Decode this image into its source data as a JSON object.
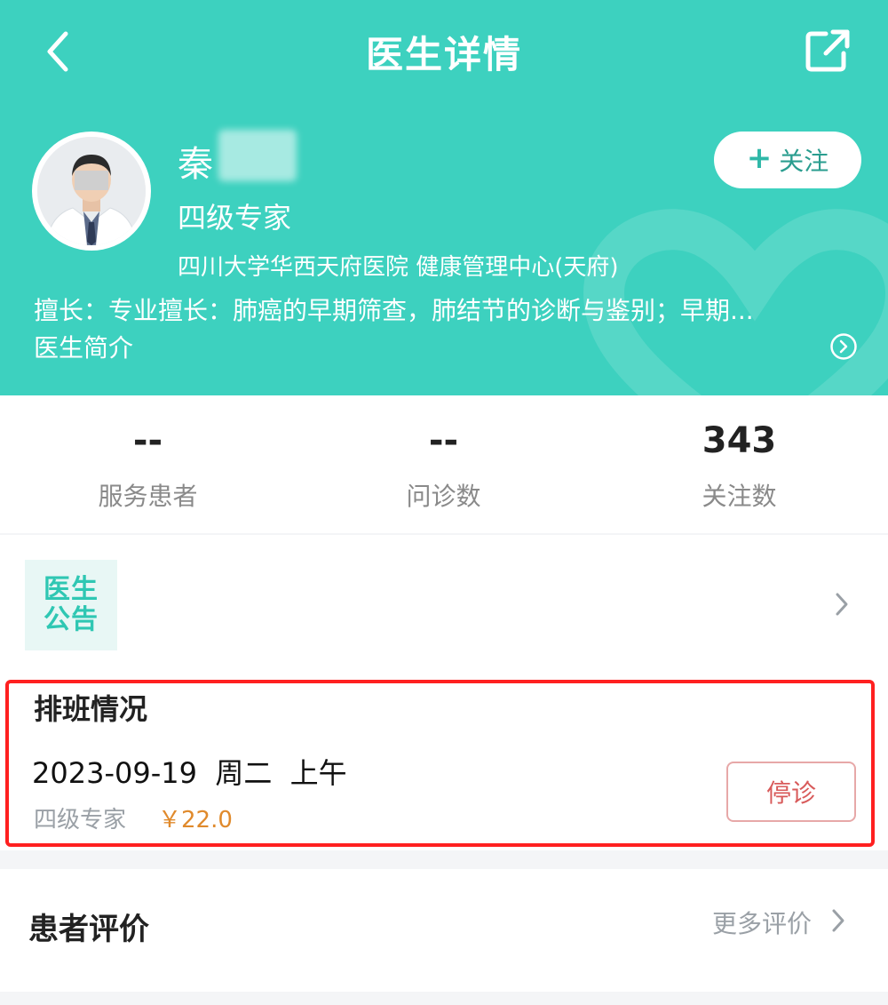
{
  "nav": {
    "title": "医生详情"
  },
  "doctor": {
    "name": "秦",
    "level": "四级专家",
    "hospital": "四川大学华西天府医院  健康管理中心(天府)",
    "specialty": "擅长：专业擅长：肺癌的早期筛查，肺结节的诊断与鉴别；早期...",
    "intro_label": "医生简介"
  },
  "follow": {
    "plus": "+",
    "label": "关注"
  },
  "stats": [
    {
      "value": "--",
      "label": "服务患者"
    },
    {
      "value": "--",
      "label": "问诊数"
    },
    {
      "value": "343",
      "label": "关注数"
    }
  ],
  "notice": {
    "line1": "医生",
    "line2": "公告"
  },
  "schedule": {
    "title": "排班情况",
    "date_line": "2023-09-19  周二  上午",
    "level": "四级专家",
    "price": "￥22.0",
    "status": "停诊"
  },
  "reviews": {
    "title": "患者评价",
    "more": "更多评价"
  },
  "colors": {
    "brand": "#3dd1bf",
    "price": "#e08a2c",
    "stop": "#d85a5a",
    "highlight": "#ff2020"
  },
  "icons": [
    "back-icon",
    "share-icon",
    "chevron-circle-right-icon",
    "chevron-right-icon"
  ]
}
